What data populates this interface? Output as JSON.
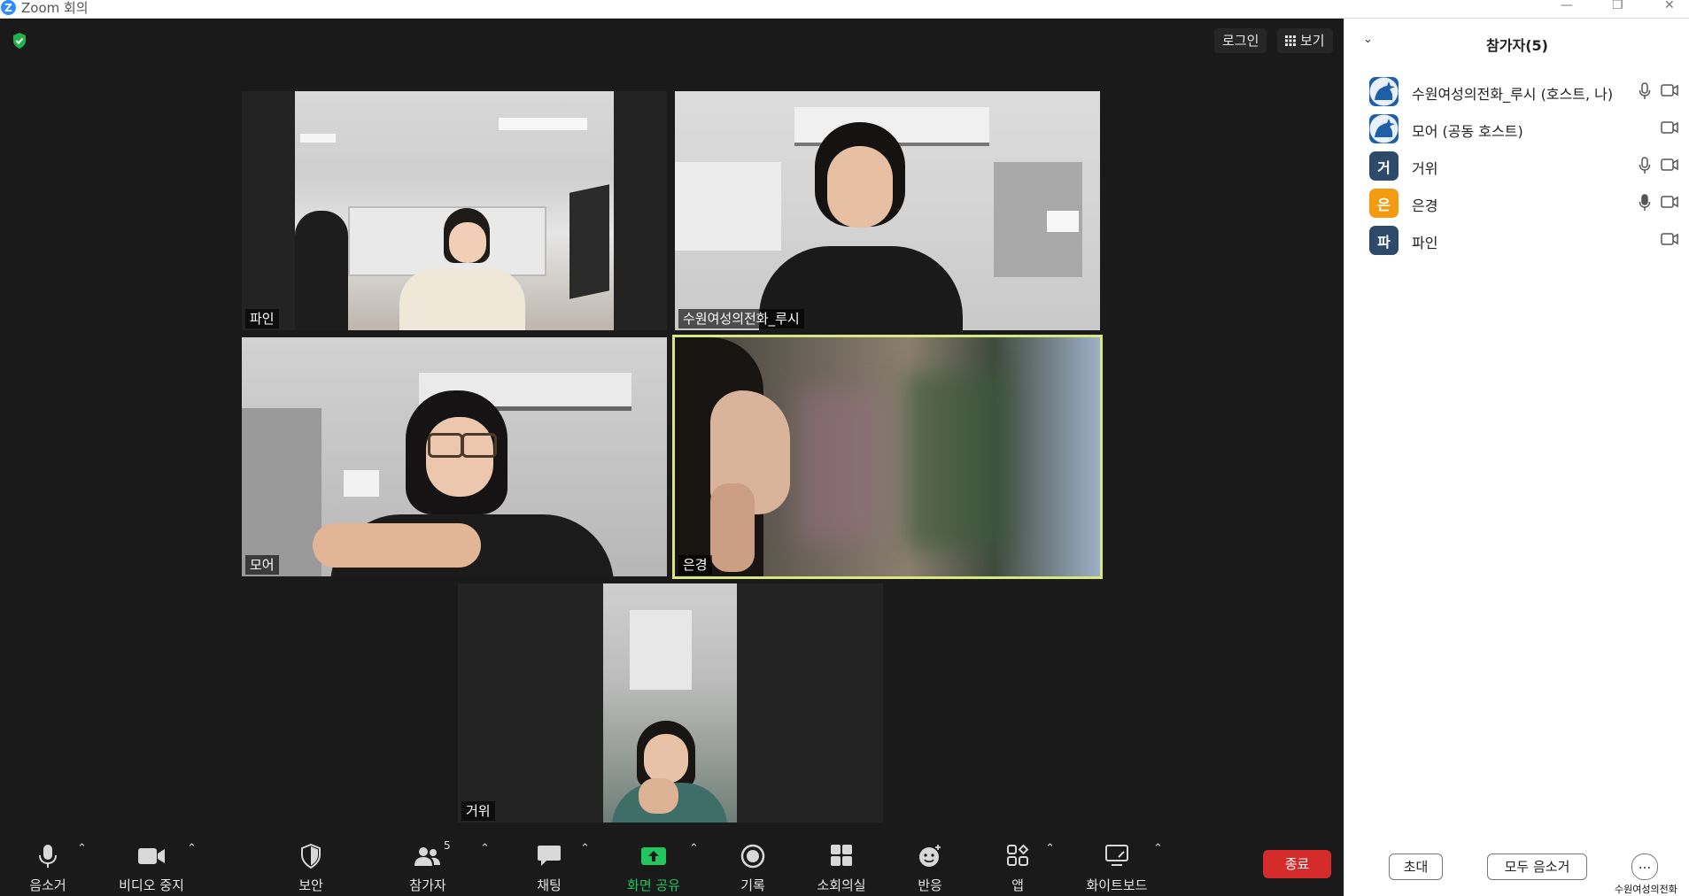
{
  "window": {
    "title": "Zoom 회의",
    "logo_letter": "Z"
  },
  "top_right": {
    "login": "로그인",
    "view": "보기"
  },
  "tiles": [
    {
      "name": "파인"
    },
    {
      "name": "수원여성의전화_루시"
    },
    {
      "name": "모어"
    },
    {
      "name": "은경"
    },
    {
      "name": "거위"
    }
  ],
  "toolbar": {
    "mute": "음소거",
    "stop_video": "비디오 중지",
    "security": "보안",
    "participants": "참가자",
    "participants_count": "5",
    "chat": "채팅",
    "share_screen": "화면 공유",
    "record": "기록",
    "breakout": "소회의실",
    "reactions": "반응",
    "apps": "앱",
    "whiteboard": "화이트보드",
    "end": "종료"
  },
  "panel": {
    "title": "참가자(5)",
    "participants": [
      {
        "avatar": "",
        "name": "수원여성의전화_루시 (호스트, 나)",
        "mic": true,
        "color": "#1f5fa8"
      },
      {
        "avatar": "",
        "name": "모어 (공동 호스트)",
        "mic": false,
        "color": "#1f5fa8"
      },
      {
        "avatar": "거",
        "name": "거위",
        "mic": true,
        "color": "#2e4a6b"
      },
      {
        "avatar": "은",
        "name": "은경",
        "mic": true,
        "color": "#f39c12"
      },
      {
        "avatar": "파",
        "name": "파인",
        "mic": false,
        "color": "#2e4a6b"
      }
    ],
    "invite": "초대",
    "mute_all": "모두 음소거",
    "more": "...",
    "watermark": "수원여성의전화"
  },
  "colors": {
    "share_green": "#22c55e",
    "end_red": "#d62b2b",
    "speaker_outline": "#d7e882"
  }
}
